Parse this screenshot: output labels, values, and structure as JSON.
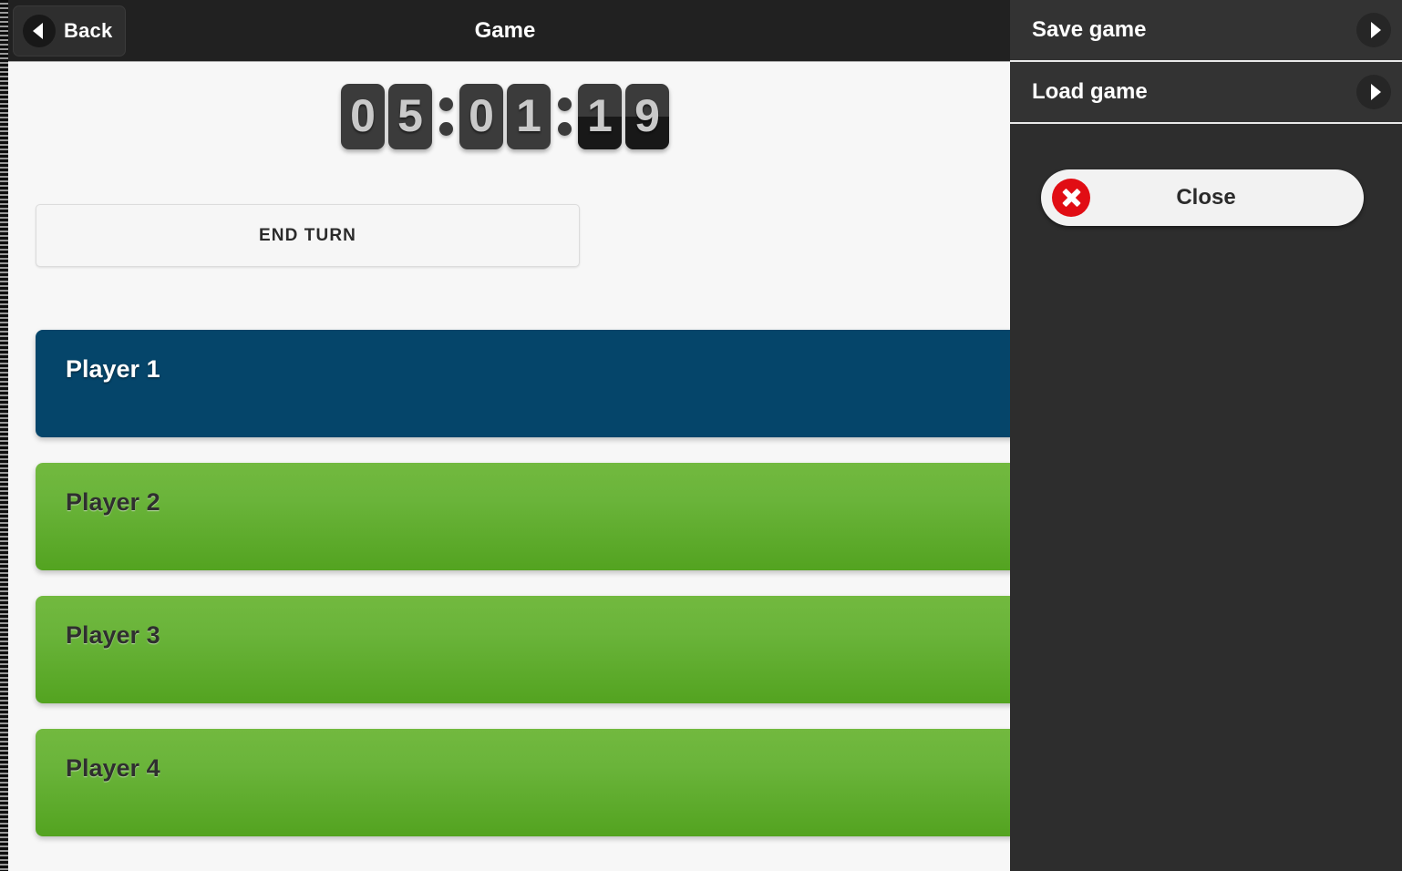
{
  "header": {
    "title": "Game",
    "back_label": "Back",
    "back_icon": "chevron-left-icon"
  },
  "timer": {
    "display": "05:01:19",
    "cells": [
      {
        "kind": "digit",
        "value": "0",
        "flipping": false
      },
      {
        "kind": "digit",
        "value": "5",
        "flipping": false
      },
      {
        "kind": "colon",
        "value": ":"
      },
      {
        "kind": "digit",
        "value": "0",
        "flipping": false
      },
      {
        "kind": "digit",
        "value": "1",
        "flipping": false
      },
      {
        "kind": "colon",
        "value": ":"
      },
      {
        "kind": "digit",
        "value": "1",
        "flipping": true
      },
      {
        "kind": "digit",
        "value": "9",
        "flipping": true
      }
    ]
  },
  "actions": {
    "end_turn_label": "END TURN"
  },
  "players": [
    {
      "name": "Player 1",
      "state": "active"
    },
    {
      "name": "Player 2",
      "state": "idle"
    },
    {
      "name": "Player 3",
      "state": "idle"
    },
    {
      "name": "Player 4",
      "state": "idle"
    }
  ],
  "sidebar": {
    "items": [
      {
        "label": "Save game",
        "icon": "chevron-right-icon"
      },
      {
        "label": "Load game",
        "icon": "chevron-right-icon"
      }
    ],
    "close": {
      "label": "Close",
      "icon": "close-x-icon"
    }
  },
  "colors": {
    "header_bg": "#212121",
    "page_bg": "#f7f7f7",
    "sidebar_bg": "#2d2d2d",
    "menu_row_bg": "#333333",
    "active_player": "#05456a",
    "idle_player_top": "#72b93f",
    "idle_player_bottom": "#53a320",
    "close_accent": "#e10d14",
    "digit_bg": "#3b3b3b",
    "digit_fg": "#c9c9c9"
  }
}
